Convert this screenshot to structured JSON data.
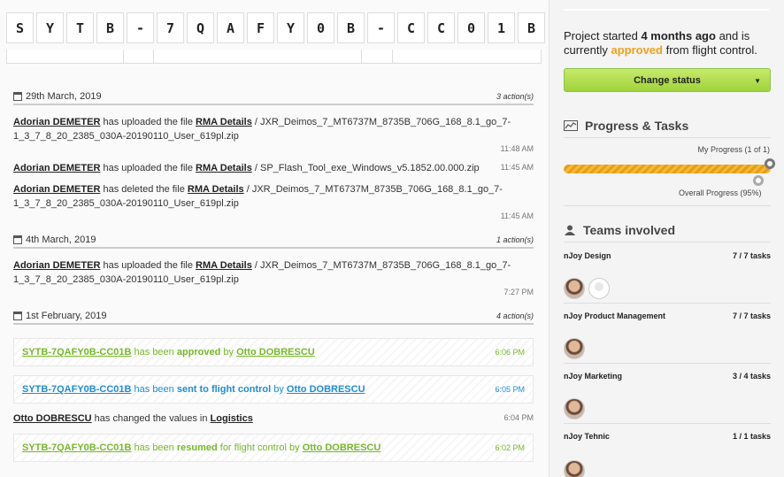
{
  "code_chars": [
    "S",
    "Y",
    "T",
    "B",
    "-",
    "7",
    "Q",
    "A",
    "F",
    "Y",
    "0",
    "B",
    "-",
    "C",
    "C",
    "0",
    "1",
    "B"
  ],
  "days": [
    {
      "date": "29th March, 2019",
      "count": "3 action(s)"
    },
    {
      "date": "4th March, 2019",
      "count": "1 action(s)"
    },
    {
      "date": "1st February, 2019",
      "count": "4 action(s)"
    }
  ],
  "entries": [
    {
      "user": "Adorian DEMETER",
      "action": " has uploaded the file ",
      "link": "RMA Details",
      "file1": " / JXR_Deimos_7_MT6737M_8735B_706G_168_8.1_go_7-",
      "file2": "1_3_7_8_20_2385_030A-20190110_User_619pl.zip",
      "time": "11:48 AM"
    },
    {
      "user": "Adorian DEMETER",
      "action": " has uploaded the file ",
      "link": "RMA Details",
      "file1": " / SP_Flash_Tool_exe_Windows_v5.1852.00.000.zip",
      "time": "11:45 AM"
    },
    {
      "user": "Adorian DEMETER",
      "action": " has deleted the file ",
      "link": "RMA Details",
      "file1": " / JXR_Deimos_7_MT6737M_8735B_706G_168_8.1_go_7-",
      "file2": "1_3_7_8_20_2385_030A-20190110_User_619pl.zip",
      "time": "11:45 AM"
    },
    {
      "user": "Adorian DEMETER",
      "action": " has uploaded the file ",
      "link": "RMA Details",
      "file1": " / JXR_Deimos_7_MT6737M_8735B_706G_168_8.1_go_7-",
      "file2": "1_3_7_8_20_2385_030A-20190110_User_619pl.zip",
      "time": "7:27 PM"
    }
  ],
  "status_events": [
    {
      "code": "SYTB-7QAFY0B-CC01B",
      "pre": " has been ",
      "word": "approved",
      "post": " by ",
      "by": "Otto DOBRESCU",
      "time": "6:06 PM"
    },
    {
      "code": "SYTB-7QAFY0B-CC01B",
      "pre": " has been ",
      "word": "sent to flight control",
      "post": " by ",
      "by": "Otto DOBRESCU",
      "time": "6:05 PM"
    },
    {
      "code": "SYTB-7QAFY0B-CC01B",
      "pre": " has been ",
      "word": "resumed",
      "post": " for flight control by ",
      "by": "Otto DOBRESCU",
      "time": "6:02 PM"
    }
  ],
  "change_entry": {
    "user": "Otto DOBRESCU",
    "action": " has changed the values in ",
    "link": "Logistics",
    "time": "6:04 PM"
  },
  "sidebar": {
    "intro_a": "Project started ",
    "intro_b": "4 months ago",
    "intro_c": " and is currently ",
    "intro_d": "approved",
    "intro_e": " from flight control.",
    "change_status": "Change status",
    "progress_title": "Progress & Tasks",
    "my_progress": "My Progress (1 of 1)",
    "overall_progress": "Overall Progress (95%)",
    "my_progress_fraction": 1.0,
    "overall_progress_fraction": 0.95,
    "teams_title": "Teams involved",
    "teams": [
      {
        "name": "nJoy Design",
        "tasks": "7 / 7 tasks"
      },
      {
        "name": "nJoy Product Management",
        "tasks": "7 / 7 tasks"
      },
      {
        "name": "nJoy Marketing",
        "tasks": "3 / 4 tasks"
      },
      {
        "name": "nJoy Tehnic",
        "tasks": "1 / 1 tasks"
      }
    ]
  },
  "colors": {
    "accent_green": "#76b82a",
    "accent_blue": "#1f8dd6",
    "approved_orange": "#f0a01e",
    "button_green": "#9fd33a"
  }
}
